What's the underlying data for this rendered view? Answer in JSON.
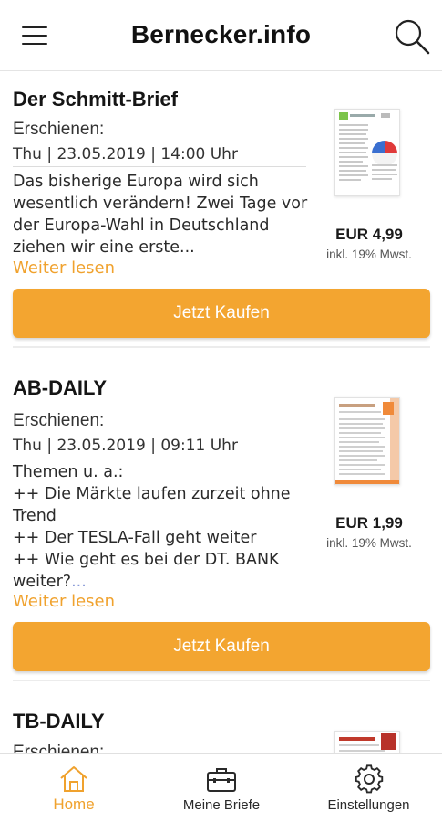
{
  "header": {
    "title": "Bernecker.info",
    "menu_icon": "hamburger-menu-icon",
    "search_icon": "search-icon"
  },
  "colors": {
    "accent": "#f3a530",
    "link": "#f0a22e",
    "text": "#1f1f1f"
  },
  "items": [
    {
      "title": "Der Schmitt-Brief",
      "published_label": "Erschienen:",
      "published_date": "Thu | 23.05.2019 | 14:00 Uhr",
      "description": "Das bisherige Europa wird sich wesentlich verändern! Zwei Tage vor der Europa-Wahl in Deutschland ziehen wir eine erste...",
      "read_more": "Weiter lesen",
      "price": "EUR 4,99",
      "vat": "inkl. 19% Mwst.",
      "buy_label": "Jetzt Kaufen"
    },
    {
      "title": "AB-DAILY",
      "published_label": "Erschienen:",
      "published_date": "Thu | 23.05.2019 | 09:11 Uhr",
      "description": "Themen u. a.:\n++ Die Märkte laufen zurzeit ohne Trend\n++ Der TESLA-Fall geht weiter\n++ Wie geht es bei der DT. BANK weiter?",
      "description_ellipsis": "...",
      "read_more": "Weiter lesen",
      "price": "EUR 1,99",
      "vat": "inkl. 19% Mwst.",
      "buy_label": "Jetzt Kaufen"
    },
    {
      "title": "TB-DAILY",
      "published_label": "Erschienen:"
    }
  ],
  "bottom_nav": [
    {
      "label": "Home",
      "icon": "home-icon",
      "active": true
    },
    {
      "label": "Meine Briefe",
      "icon": "briefcase-icon",
      "active": false
    },
    {
      "label": "Einstellungen",
      "icon": "gear-icon",
      "active": false
    }
  ]
}
